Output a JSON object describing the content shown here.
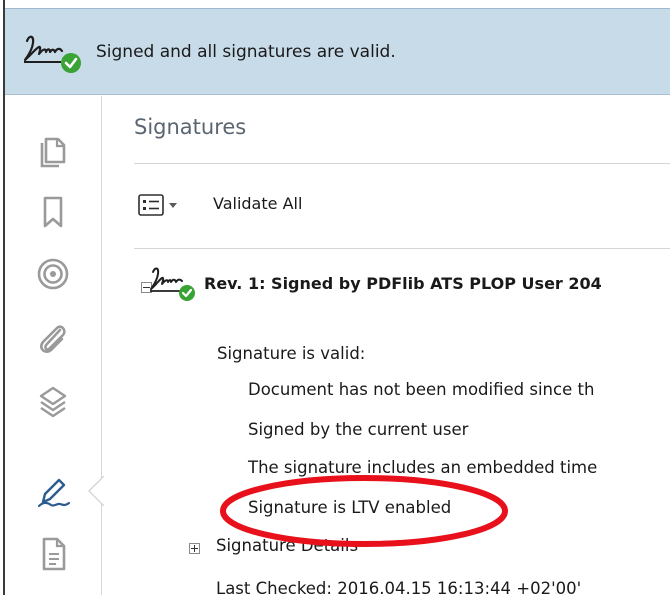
{
  "message_bar": {
    "text": "Signed and all signatures are valid.",
    "icon": "signature-valid-icon"
  },
  "nav_panel": {
    "icons": [
      "pages-icon",
      "bookmark-icon",
      "target-icon",
      "attachment-icon",
      "layers-icon",
      "signature-pen-icon",
      "document-icon"
    ],
    "active": "signature-pen-icon"
  },
  "signatures_panel": {
    "title": "Signatures",
    "options_icon": "options-list-icon",
    "validate_all_label": "Validate All",
    "revision": {
      "title": "Rev. 1: Signed by PDFlib ATS PLOP User 204",
      "status_heading": "Signature is valid:",
      "details": [
        "Document has not been modified since th",
        "Signed by the current user",
        "The signature includes an embedded time",
        "Signature is LTV enabled"
      ],
      "signature_details_label": "Signature Details",
      "last_checked": "Last Checked: 2016.04.15 16:13:44 +02'00'"
    }
  },
  "annotation": {
    "highlight_color": "#e8101a",
    "highlighted_item": "Signature is LTV enabled"
  },
  "colors": {
    "message_bar_bg": "#c8dbe9",
    "valid_check": "#3aa335",
    "icon_gray": "#9a9a9a",
    "active_icon": "#2c5c8e"
  }
}
